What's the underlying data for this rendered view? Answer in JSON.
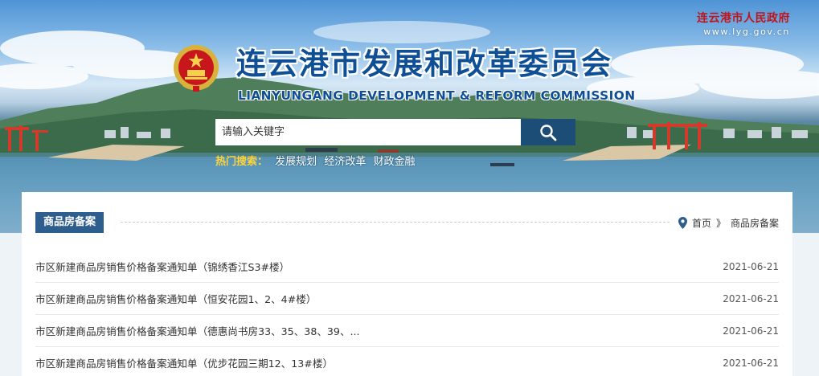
{
  "header": {
    "gov_name": "连云港市人民政府",
    "gov_url": "www.lyg.gov.cn",
    "title_cn": "连云港市发展和改革委员会",
    "title_en": "LIANYUNGANG DEVELOPMENT & REFORM COMMISSION"
  },
  "search": {
    "placeholder": "请输入关键字",
    "button_icon": "search-icon"
  },
  "hot_search": {
    "label": "热门搜索：",
    "items": [
      "发展规划",
      "经济改革",
      "财政金融"
    ]
  },
  "section": {
    "title": "商品房备案"
  },
  "breadcrumb": {
    "icon": "location-pin-icon",
    "home": "首页",
    "separator": "》",
    "current": "商品房备案"
  },
  "list": [
    {
      "title": "市区新建商品房销售价格备案通知单（锦绣香江S3#楼）",
      "date": "2021-06-21"
    },
    {
      "title": "市区新建商品房销售价格备案通知单（恒安花园1、2、4#楼）",
      "date": "2021-06-21"
    },
    {
      "title": "市区新建商品房销售价格备案通知单（德惠尚书房33、35、38、39、...",
      "date": "2021-06-21"
    },
    {
      "title": "市区新建商品房销售价格备案通知单（优步花园三期12、13#楼）",
      "date": "2021-06-21"
    }
  ],
  "colors": {
    "title_blue": "#0f4f95",
    "gov_red": "#c0151c",
    "search_button": "#1c4d76",
    "section_tab": "#2e5e8e",
    "hot_label": "#ffd43b"
  }
}
